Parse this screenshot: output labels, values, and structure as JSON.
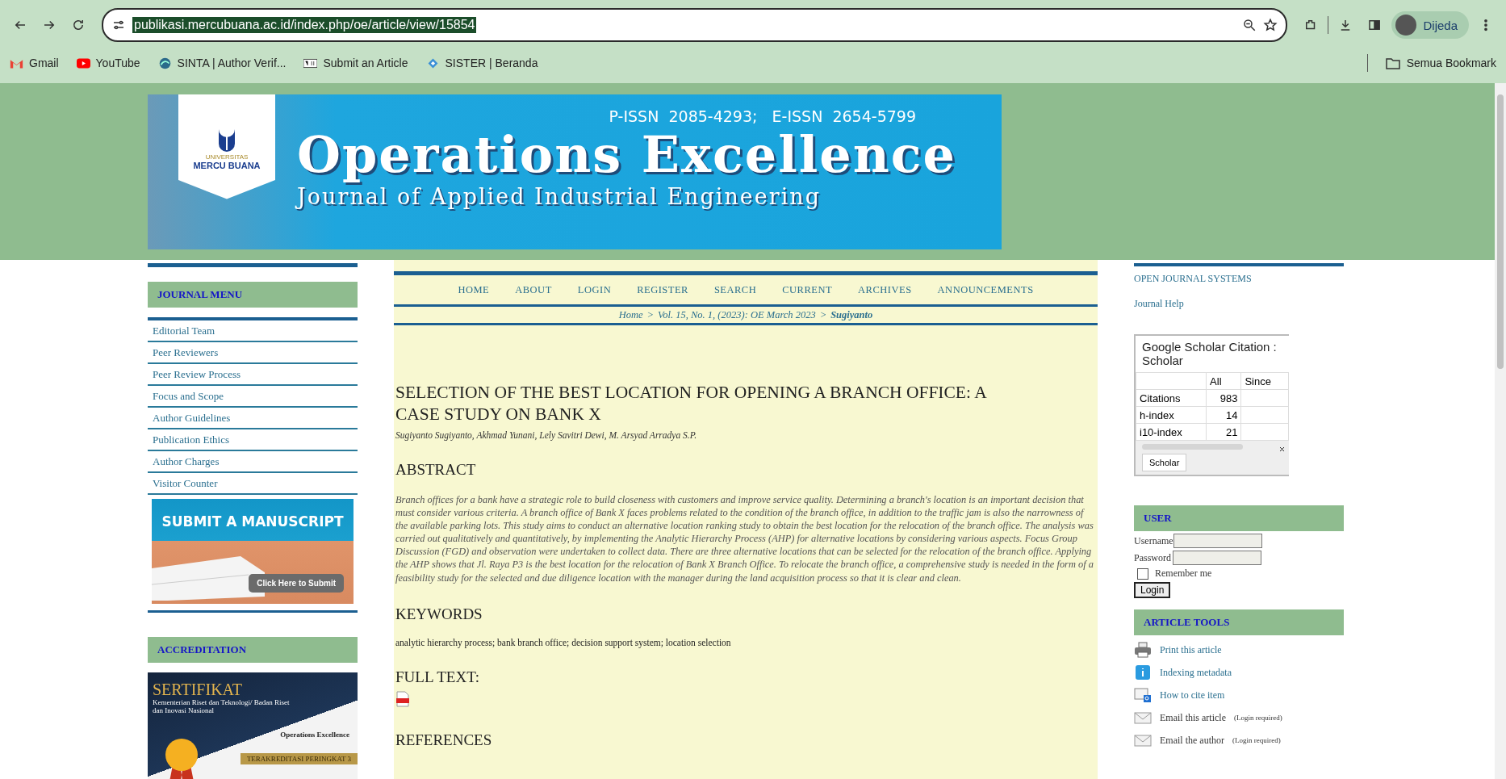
{
  "browser": {
    "url": "publikasi.mercubuana.ac.id/index.php/oe/article/view/15854",
    "url_selected": true,
    "profile": "Dijeda",
    "bookmarks": [
      {
        "label": "Gmail",
        "kind": "gmail"
      },
      {
        "label": "YouTube",
        "kind": "youtube"
      },
      {
        "label": "SINTA | Author Verif...",
        "kind": "sinta"
      },
      {
        "label": "Submit an Article",
        "kind": "pkp"
      },
      {
        "label": "SISTER | Beranda",
        "kind": "sister"
      }
    ],
    "all_bookmarks": "Semua Bookmark"
  },
  "header": {
    "logo_small": "UNIVERSITAS",
    "logo": "MERCU BUANA",
    "issn": "P-ISSN  2085-4293;   E-ISSN  2654-5799",
    "title": "Operations Excellence",
    "subtitle": "Journal of Applied Industrial Engineering"
  },
  "left_sidebar": {
    "menu_title": "JOURNAL MENU",
    "menu_items": [
      "Editorial Team",
      "Peer Reviewers",
      "Peer Review Process",
      "Focus and Scope",
      "Author Guidelines",
      "Publication Ethics",
      "Author Charges",
      "Visitor Counter"
    ],
    "submit_banner": {
      "title": "SUBMIT A MANUSCRIPT",
      "button": "Click Here to Submit"
    },
    "accreditation_title": "ACCREDITATION",
    "certificate": {
      "title": "SERTIFIKAT",
      "subtitle": "Kementerian Riset dan Teknologi/ Badan Riset dan Inovasi Nasional",
      "journal": "Operations Excellence",
      "ribbon": "TERAKREDITASI PERINGKAT 3"
    }
  },
  "nav": [
    "HOME",
    "ABOUT",
    "LOGIN",
    "REGISTER",
    "SEARCH",
    "CURRENT",
    "ARCHIVES",
    "ANNOUNCEMENTS"
  ],
  "breadcrumb": {
    "separator": ">",
    "items": [
      {
        "label": "Home",
        "current": false
      },
      {
        "label": "Vol. 15, No. 1, (2023): OE March 2023",
        "current": false
      },
      {
        "label": "Sugiyanto",
        "current": true
      }
    ]
  },
  "article": {
    "title": "SELECTION OF THE BEST LOCATION FOR OPENING A BRANCH OFFICE: A CASE STUDY ON BANK X",
    "authors": "Sugiyanto Sugiyanto, Akhmad Yunani, Lely Savitri Dewi, M. Arsyad Arradya S.P.",
    "abstract_heading": "ABSTRACT",
    "abstract": "Branch offices for a bank have a strategic role to build closeness with customers and improve service quality. Determining a branch's location is an important decision that must consider various criteria. A branch office of Bank X faces problems related to the condition of the branch office, in addition to the traffic jam is also the narrowness of the available parking lots. This study aims to conduct an alternative location ranking study to obtain the best location for the relocation of the branch office. The analysis was carried out qualitatively and quantitatively, by implementing the Analytic Hierarchy Process (AHP) for alternative locations by considering various aspects. Focus Group Discussion (FGD) and observation were undertaken to collect data. There are three alternative locations that can be selected for the relocation of the branch office. Applying the AHP shows that Jl. Raya P3 is the best location for the relocation of Bank X Branch Office. To relocate the branch office, a comprehensive study is needed in the form of a feasibility study for the selected and due diligence location with the manager during the land acquisition process so that it is clear and clean.",
    "keywords_heading": "KEYWORDS",
    "keywords": "analytic hierarchy process; bank branch office; decision support system; location selection",
    "fulltext_heading": "FULL TEXT:",
    "references_heading": "REFERENCES"
  },
  "right_sidebar": {
    "ojs": "OPEN JOURNAL SYSTEMS",
    "help": "Journal Help",
    "scholar": {
      "title": "Google Scholar Citation : Scholar",
      "columns": [
        "All",
        "Since"
      ],
      "rows": [
        {
          "label": "Citations",
          "all": "983"
        },
        {
          "label": "h-index",
          "all": "14"
        },
        {
          "label": "i10-index",
          "all": "21"
        }
      ],
      "tab": "Scholar"
    },
    "user": {
      "title": "USER",
      "username_label": "Username",
      "password_label": "Password",
      "remember": "Remember me",
      "remember_checked": false,
      "login": "Login"
    },
    "tools_title": "ARTICLE TOOLS",
    "tools": [
      {
        "label": "Print this article",
        "kind": "print"
      },
      {
        "label": "Indexing metadata",
        "kind": "info"
      },
      {
        "label": "How to cite item",
        "kind": "cite"
      },
      {
        "label": "Email this article",
        "kind": "email",
        "note": "(Login required)"
      },
      {
        "label": "Email the author",
        "kind": "email",
        "note": "(Login required)"
      }
    ]
  }
}
